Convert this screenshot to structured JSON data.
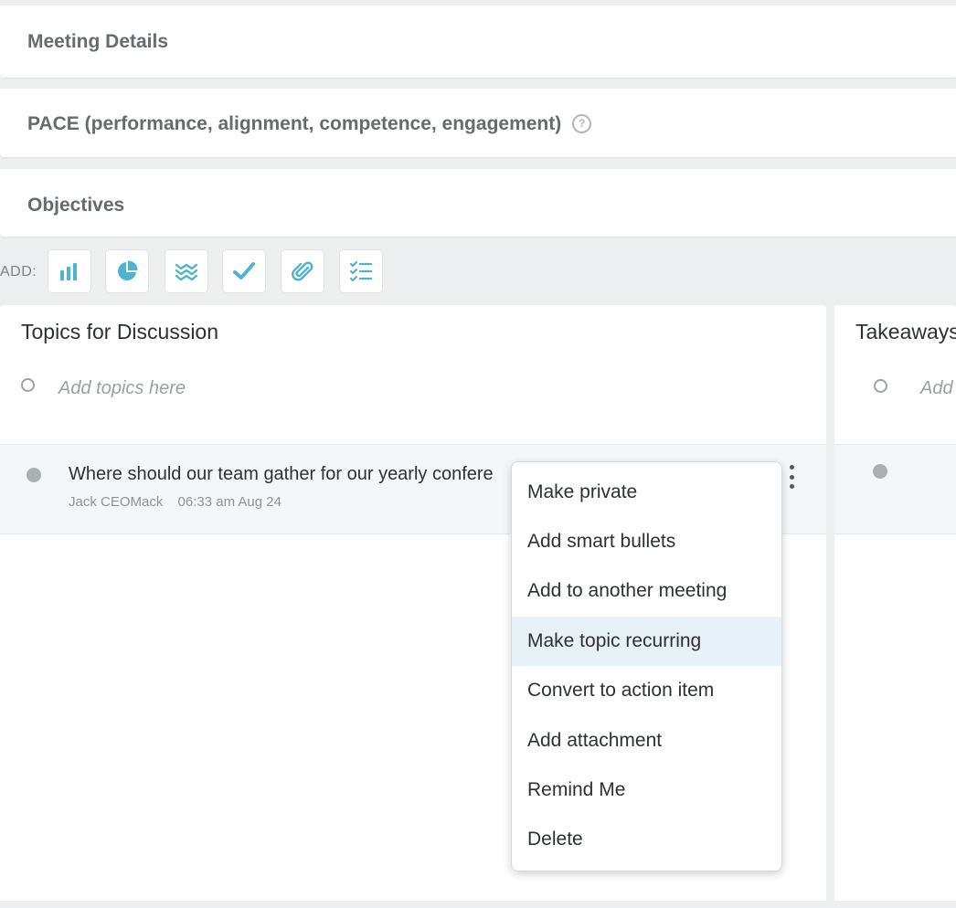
{
  "sections": {
    "meeting_details": "Meeting Details",
    "pace": "PACE (performance, alignment, competence, engagement)",
    "objectives": "Objectives"
  },
  "toolbar": {
    "add_label": "ADD:",
    "accent_color": "#4fb3cf",
    "buttons": [
      {
        "icon": "bar-chart-icon"
      },
      {
        "icon": "pie-chart-icon"
      },
      {
        "icon": "waves-icon"
      },
      {
        "icon": "checkmark-icon"
      },
      {
        "icon": "paperclip-icon"
      },
      {
        "icon": "checklist-icon"
      }
    ]
  },
  "topics_panel": {
    "title": "Topics for Discussion",
    "add_placeholder": "Add topics here",
    "topic": {
      "text": "Where should our team gather for our yearly confere",
      "author": "Jack CEOMack",
      "time": "06:33 am Aug 24"
    }
  },
  "takeaways_panel": {
    "title": "Takeaways",
    "add_placeholder": "Add"
  },
  "context_menu": {
    "items": [
      {
        "label": "Make private"
      },
      {
        "label": "Add smart bullets"
      },
      {
        "label": "Add to another meeting"
      },
      {
        "label": "Make topic recurring",
        "highlighted": true
      },
      {
        "label": "Convert to action item"
      },
      {
        "label": "Add attachment"
      },
      {
        "label": "Remind Me"
      },
      {
        "label": "Delete"
      }
    ]
  }
}
